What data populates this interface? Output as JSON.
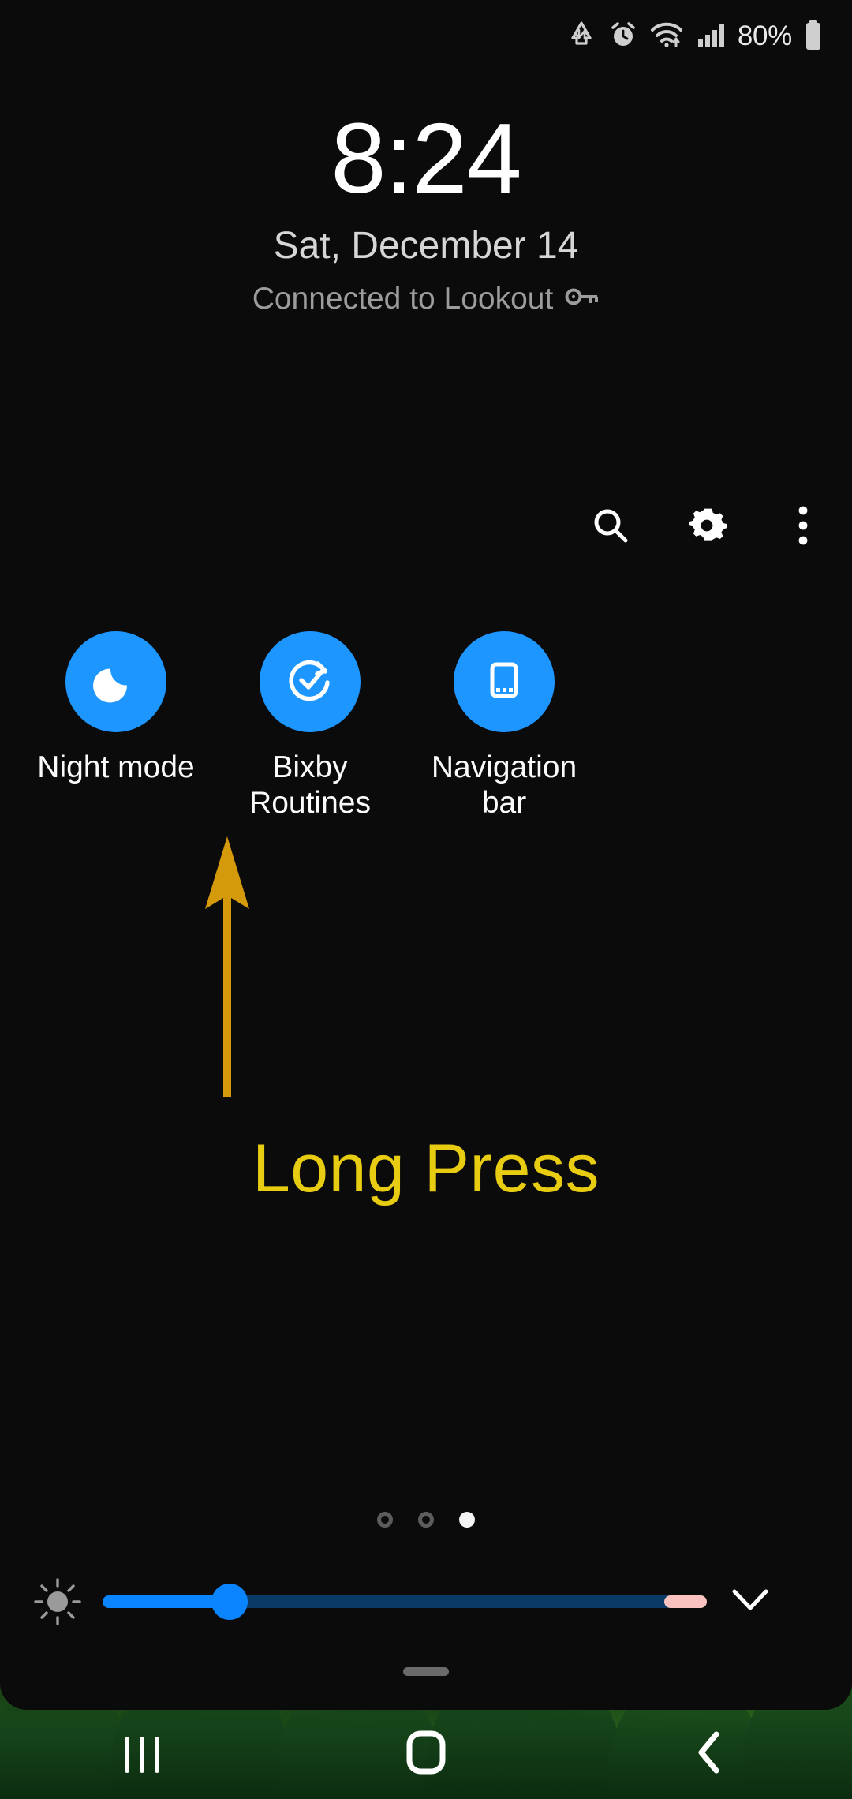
{
  "status_bar": {
    "icons": [
      "data-saver-icon",
      "alarm-icon",
      "wifi-icon",
      "cellular-signal-icon"
    ],
    "battery_percent": "80%",
    "battery_icon": "battery-icon"
  },
  "lock_screen": {
    "time": "8:24",
    "date": "Sat, December 14",
    "vpn_status": "Connected to Lookout",
    "vpn_icon": "vpn-key-icon"
  },
  "toolbar": {
    "search_icon": "search-icon",
    "settings_icon": "gear-icon",
    "more_icon": "more-vertical-icon"
  },
  "tiles": [
    {
      "label": "Night mode",
      "icon": "moon-icon",
      "state": "on",
      "color": "#1e96ff"
    },
    {
      "label": "Bixby\nRoutines",
      "icon": "routine-check-icon",
      "state": "on",
      "color": "#1e96ff"
    },
    {
      "label": "Navigation\nbar",
      "icon": "phone-navbar-icon",
      "state": "on",
      "color": "#1e96ff"
    }
  ],
  "annotation": {
    "text": "Long Press",
    "text_color": "#e8cc12",
    "arrow_color": "#d49a0c",
    "arrow_icon": "up-arrow-annotation"
  },
  "page_indicator": {
    "total": 3,
    "active_index": 2
  },
  "brightness": {
    "icon": "brightness-icon",
    "value_percent": 21,
    "auto_marker_start_percent": 93,
    "auto_marker_end_percent": 100,
    "fill_color": "#0a84ff",
    "track_color": "#0a3a66",
    "auto_color": "#fac3c0",
    "expand_icon": "chevron-down-icon"
  },
  "panel": {
    "handle_icon": "drag-handle"
  },
  "nav_bar": {
    "recents_icon": "recents-icon",
    "home_icon": "home-icon",
    "back_icon": "back-icon"
  }
}
